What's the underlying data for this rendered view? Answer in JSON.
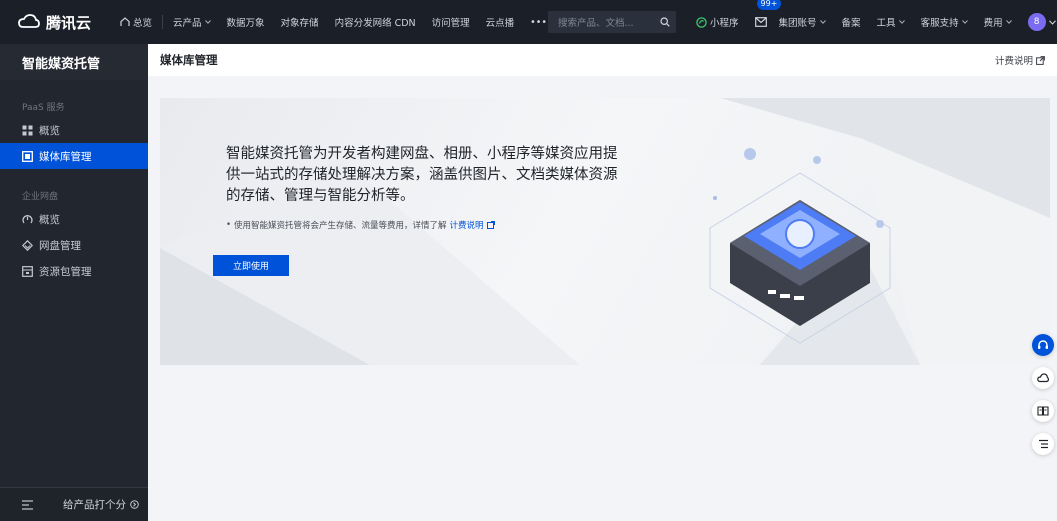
{
  "topbar": {
    "brand": "腾讯云",
    "overview": "总览",
    "nav": [
      {
        "label": "云产品",
        "dropdown": true
      },
      {
        "label": "数据万象",
        "dropdown": false
      },
      {
        "label": "对象存储",
        "dropdown": false
      },
      {
        "label": "内容分发网络 CDN",
        "dropdown": false
      },
      {
        "label": "访问管理",
        "dropdown": false
      },
      {
        "label": "云点播",
        "dropdown": false
      }
    ],
    "more": "•••",
    "search_placeholder": "搜索产品、文档...",
    "mini_program": "小程序",
    "message_badge": "99+",
    "right": [
      {
        "label": "集团账号",
        "dropdown": true
      },
      {
        "label": "备案",
        "dropdown": false
      },
      {
        "label": "工具",
        "dropdown": true
      },
      {
        "label": "客服支持",
        "dropdown": true
      },
      {
        "label": "费用",
        "dropdown": true
      }
    ],
    "avatar": "8"
  },
  "sidebar": {
    "title": "智能媒资托管",
    "group1": "PaaS 服务",
    "group1_items": [
      {
        "label": "概览",
        "icon": "grid-icon"
      },
      {
        "label": "媒体库管理",
        "icon": "media-library-icon",
        "active": true
      }
    ],
    "group2": "企业网盘",
    "group2_items": [
      {
        "label": "概览",
        "icon": "dashboard-icon"
      },
      {
        "label": "网盘管理",
        "icon": "diamond-icon"
      },
      {
        "label": "资源包管理",
        "icon": "package-icon"
      }
    ],
    "feedback": "给产品打个分"
  },
  "header": {
    "title": "媒体库管理",
    "billing": "计费说明"
  },
  "banner": {
    "description": "智能媒资托管为开发者构建网盘、相册、小程序等媒资应用提供一站式的存储处理解决方案，涵盖供图片、文档类媒体资源的存储、管理与智能分析等。",
    "note": "使用智能媒资托管将会产生存储、流量等费用，详情了解",
    "note_link": "计费说明",
    "cta": "立即使用"
  },
  "colors": {
    "accent": "#0052d9",
    "topbar": "#1b1f27",
    "sidebar": "#22262e"
  }
}
